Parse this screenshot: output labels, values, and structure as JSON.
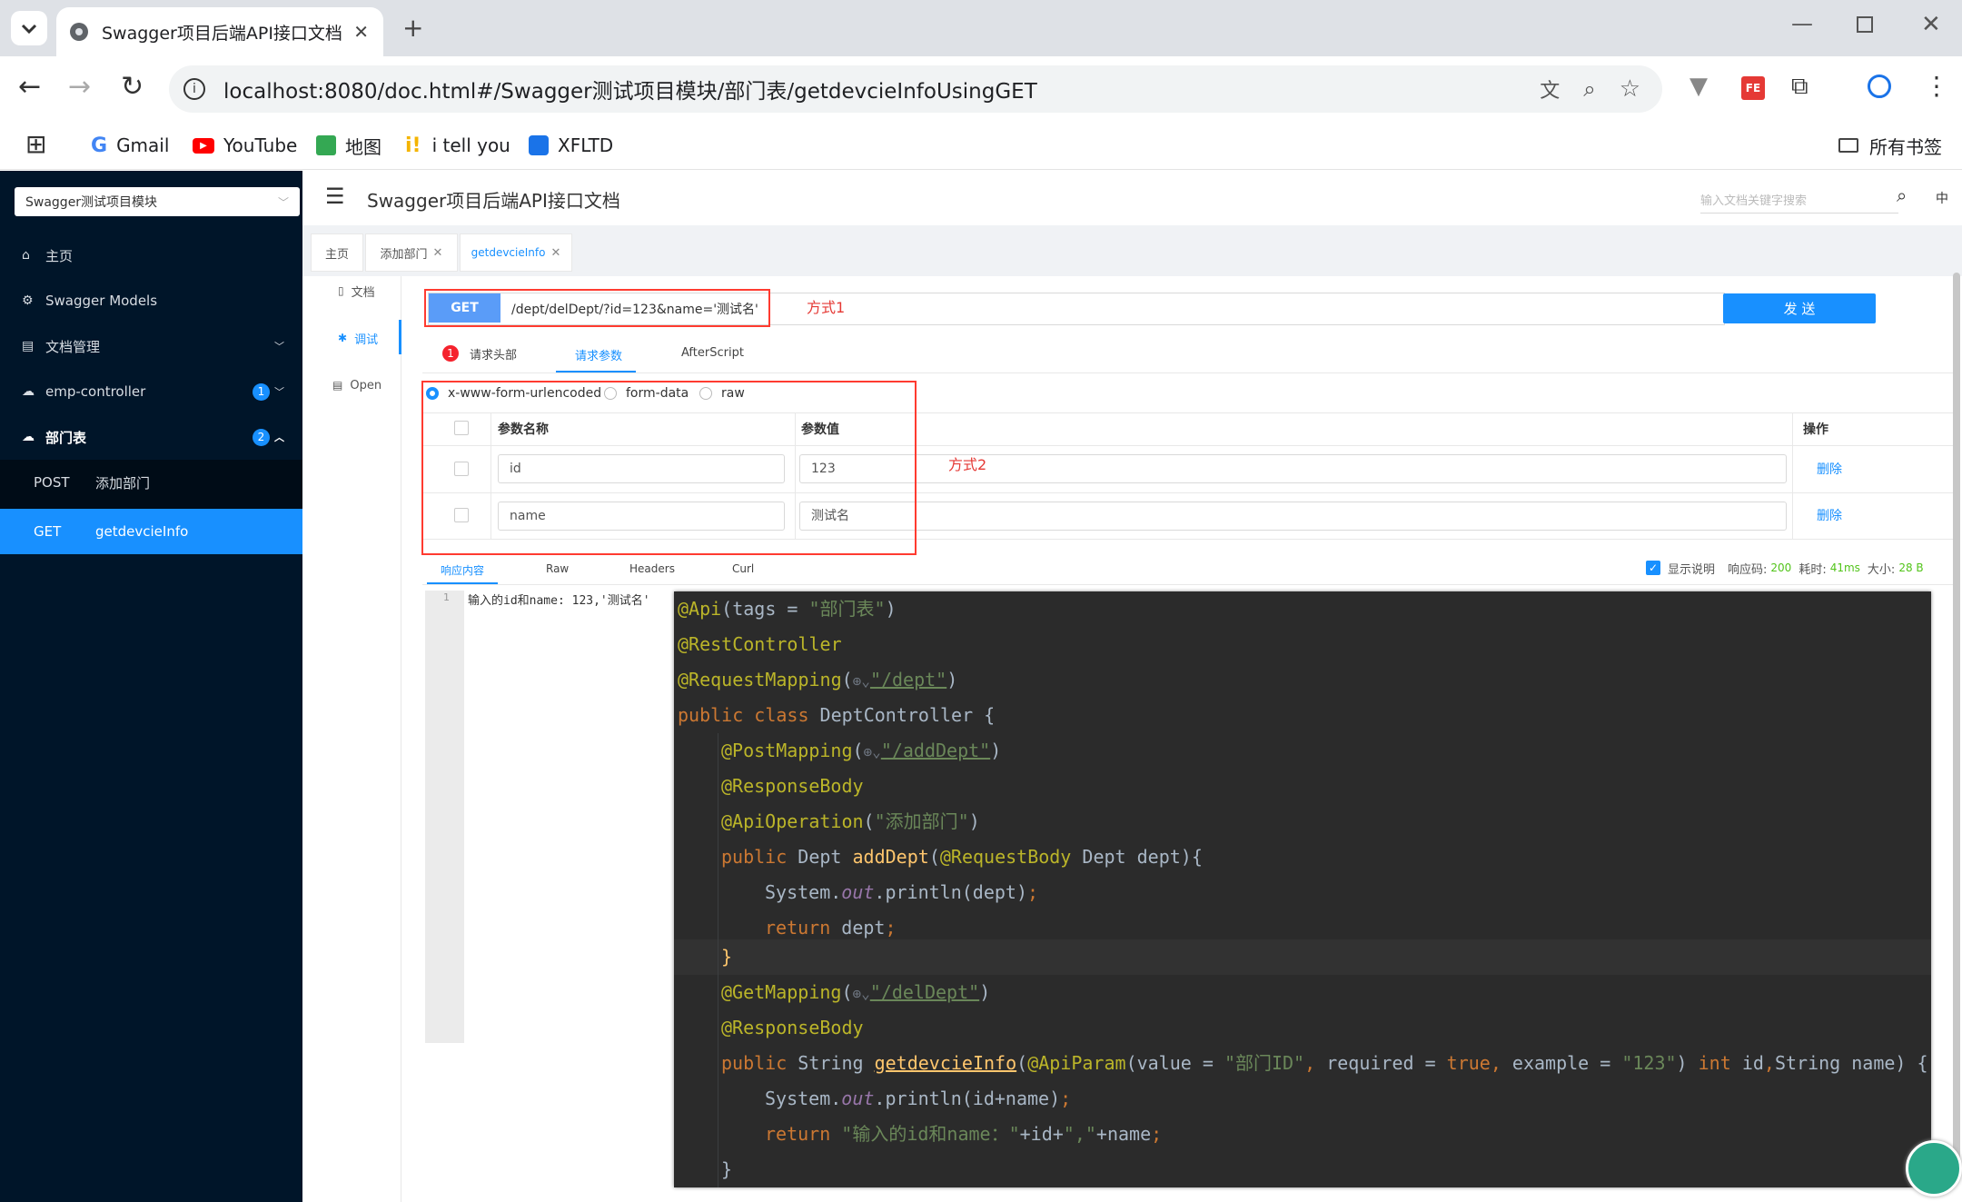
{
  "browser": {
    "tab_title": "Swagger项目后端API接口文档",
    "url": "localhost:8080/doc.html#/Swagger测试项目模块/部门表/getdevcieInfoUsingGET",
    "bookmarks": [
      "Gmail",
      "YouTube",
      "地图",
      "i tell you",
      "XFLTD"
    ],
    "all_bookmarks": "所有书签"
  },
  "sidebar": {
    "module_select": "Swagger测试项目模块",
    "items": [
      {
        "label": "主页"
      },
      {
        "label": "Swagger Models"
      },
      {
        "label": "文档管理"
      },
      {
        "label": "emp-controller",
        "badge": "1"
      },
      {
        "label": "部门表",
        "badge": "2"
      }
    ],
    "sub_items": [
      {
        "method": "POST",
        "label": "添加部门"
      },
      {
        "method": "GET",
        "label": "getdevcieInfo"
      }
    ]
  },
  "header": {
    "title": "Swagger项目后端API接口文档",
    "search_placeholder": "输入文档关键字搜索",
    "lang": "中"
  },
  "page_tabs": [
    "主页",
    "添加部门",
    "getdevcieInfo"
  ],
  "doc_nav": [
    "文档",
    "调试",
    "Open"
  ],
  "request": {
    "method": "GET",
    "url": "/dept/delDept/?id=123&name='测试名'",
    "send": "发 送",
    "annotation1": "方式1",
    "annotation2": "方式2",
    "subtabs": {
      "headers": "请求头部",
      "headers_badge": "1",
      "params": "请求参数",
      "after": "AfterScript"
    },
    "body_types": [
      "x-www-form-urlencoded",
      "form-data",
      "raw"
    ],
    "table": {
      "headers": [
        "参数名称",
        "参数值",
        "操作"
      ],
      "rows": [
        {
          "name": "id",
          "value": "123",
          "action": "删除"
        },
        {
          "name": "name",
          "value": "测试名",
          "action": "删除"
        }
      ]
    }
  },
  "response": {
    "tabs": [
      "响应内容",
      "Raw",
      "Headers",
      "Curl"
    ],
    "show_desc": "显示说明",
    "code_label": "响应码:",
    "code": "200",
    "time_label": "耗时:",
    "time": "41ms",
    "size_label": "大小:",
    "size": "28 B",
    "line_no": "1",
    "body": "输入的id和name: 123,'测试名'"
  },
  "code_lines": [
    "@Api(tags = \"部门表\")",
    "@RestController",
    "@RequestMapping(\"/dept\")",
    "public class DeptController {",
    "@PostMapping(\"/addDept\")",
    "@ResponseBody",
    "@ApiOperation(\"添加部门\")",
    "public Dept addDept(@RequestBody Dept dept){",
    "System.out.println(dept);",
    "return dept;",
    "}",
    "@GetMapping(\"/delDept\")",
    "@ResponseBody",
    "public String getdevcieInfo(@ApiParam(value = \"部门ID\", required = true, example = \"123\") int id,String name) {",
    "System.out.println(id+name);",
    "return \"输入的id和name：\"+id+\",\"+name;",
    "}"
  ]
}
